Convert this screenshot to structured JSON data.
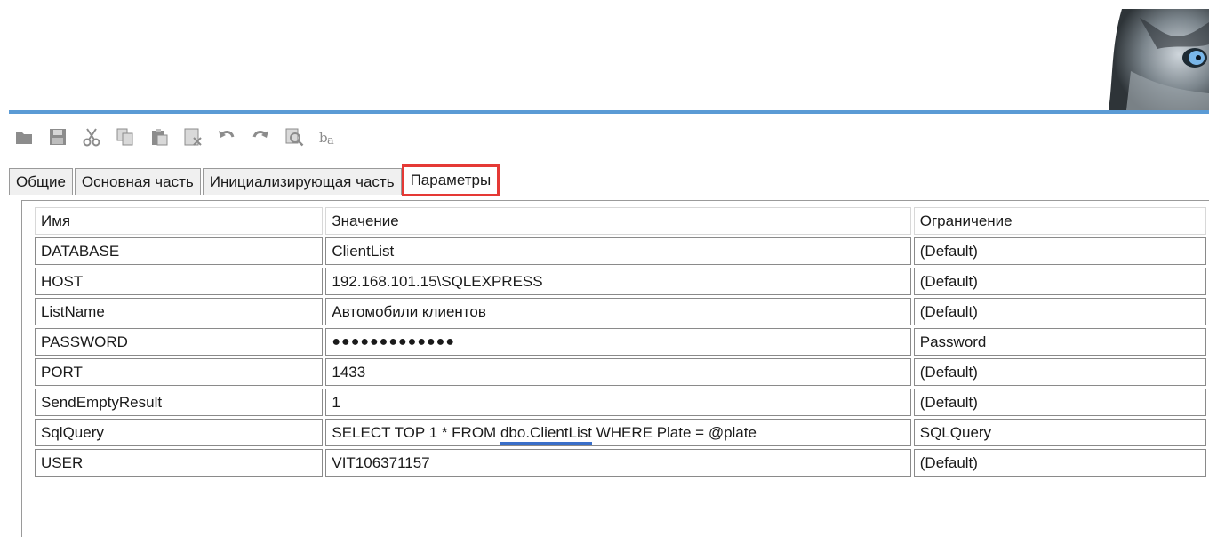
{
  "tabs": [
    {
      "label": "Общие"
    },
    {
      "label": "Основная часть"
    },
    {
      "label": "Инициализирующая часть"
    },
    {
      "label": "Параметры"
    }
  ],
  "table": {
    "headers": [
      "Имя",
      "Значение",
      "Ограничение"
    ],
    "rows": [
      {
        "name": "DATABASE",
        "value": "ClientList",
        "constraint": "(Default)"
      },
      {
        "name": "HOST",
        "value": "192.168.101.15\\SQLEXPRESS",
        "constraint": "(Default)"
      },
      {
        "name": "ListName",
        "value": "Автомобили клиентов",
        "constraint": "(Default)"
      },
      {
        "name": "PASSWORD",
        "value": "●●●●●●●●●●●●●",
        "constraint": "Password"
      },
      {
        "name": "PORT",
        "value": "1433",
        "constraint": "(Default)"
      },
      {
        "name": "SendEmptyResult",
        "value": "1",
        "constraint": "(Default)"
      },
      {
        "name": "SqlQuery",
        "value_pre": "SELECT TOP 1 * FROM ",
        "value_highlight": "dbo.ClientList",
        "value_post": " WHERE Plate = @plate",
        "constraint": "SQLQuery"
      },
      {
        "name": "USER",
        "value": "VIT106371157",
        "constraint": "(Default)"
      }
    ]
  }
}
